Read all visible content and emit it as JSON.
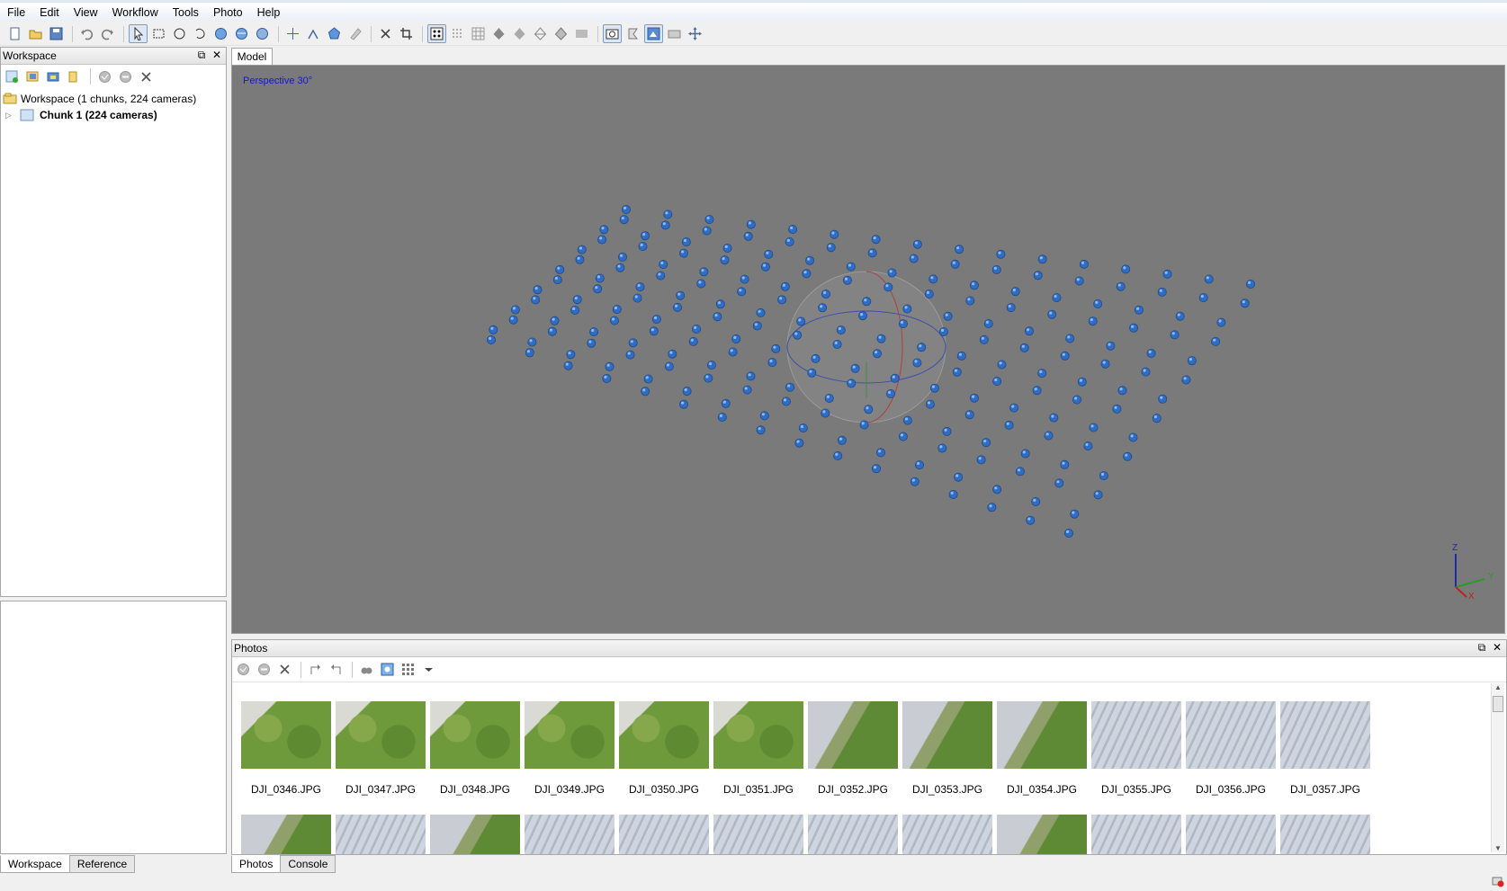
{
  "menu": [
    "File",
    "Edit",
    "View",
    "Workflow",
    "Tools",
    "Photo",
    "Help"
  ],
  "toolbar_icons": [
    "new-document-icon",
    "open-folder-icon",
    "save-icon",
    "undo-icon",
    "redo-icon",
    "navigation-arrow-icon",
    "rectangle-selection-icon",
    "circle-selection-icon",
    "free-form-selection-icon",
    "resize-region-icon",
    "rotate-region-icon",
    "rotate-object-icon",
    "ruler-point-icon",
    "ruler-icon",
    "polygon-icon",
    "eraser-icon",
    "delete-icon",
    "crop-icon",
    "point-cloud-icon",
    "dense-cloud-icon",
    "tiled-model-icon",
    "shaded-model-icon",
    "solid-model-icon",
    "wireframe-model-icon",
    "textured-model-icon",
    "dem-icon",
    "show-cameras-icon",
    "show-markers-icon",
    "show-shapes-icon",
    "show-region-icon",
    "reset-view-icon"
  ],
  "workspace": {
    "title": "Workspace",
    "toolbar_icons": [
      "add-chunk-icon",
      "add-photos-icon",
      "add-folder-icon",
      "add-markers-icon",
      "enable-icon",
      "disable-icon",
      "remove-icon"
    ],
    "root_label": "Workspace (1 chunks, 224 cameras)",
    "chunk_label": "Chunk 1 (224 cameras)"
  },
  "left_tabs": [
    "Workspace",
    "Reference"
  ],
  "model": {
    "tab": "Model",
    "view_mode": "Perspective 30°",
    "axis_labels": {
      "z": "Z",
      "y": "Y",
      "x": "X"
    },
    "camera_count": 224,
    "colors": {
      "background": "#7a7a7a",
      "camera": "#2f6cc2",
      "camera_highlight": "#8cb8f0"
    }
  },
  "photos": {
    "title": "Photos",
    "toolbar_icons": [
      "enable-cameras-icon",
      "disable-cameras-icon",
      "remove-cameras-icon",
      "rotate-right-icon",
      "rotate-left-icon",
      "filter-icon",
      "reset-filter-icon",
      "view-mode-icon",
      "dropdown-arrow-icon"
    ],
    "items": [
      {
        "name": "DJI_0346.JPG",
        "tone": "forest"
      },
      {
        "name": "DJI_0347.JPG",
        "tone": "forest"
      },
      {
        "name": "DJI_0348.JPG",
        "tone": "forest"
      },
      {
        "name": "DJI_0349.JPG",
        "tone": "forest"
      },
      {
        "name": "DJI_0350.JPG",
        "tone": "forest"
      },
      {
        "name": "DJI_0351.JPG",
        "tone": "forest"
      },
      {
        "name": "DJI_0352.JPG",
        "tone": "mixed"
      },
      {
        "name": "DJI_0353.JPG",
        "tone": "mixed"
      },
      {
        "name": "DJI_0354.JPG",
        "tone": "mixed"
      },
      {
        "name": "DJI_0355.JPG",
        "tone": "quarry"
      },
      {
        "name": "DJI_0356.JPG",
        "tone": "quarry"
      },
      {
        "name": "DJI_0357.JPG",
        "tone": "quarry"
      }
    ],
    "second_row_tones": [
      "mixed",
      "quarry",
      "mixed",
      "quarry",
      "quarry",
      "quarry",
      "quarry",
      "quarry",
      "mixed",
      "quarry",
      "quarry",
      "quarry"
    ]
  },
  "bottom_tabs": [
    "Photos",
    "Console"
  ]
}
